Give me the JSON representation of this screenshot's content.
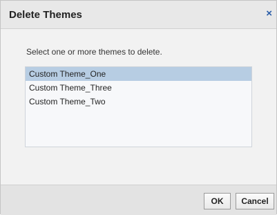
{
  "dialog": {
    "title": "Delete Themes",
    "close_glyph": "×",
    "instruction": "Select one or more themes to delete.",
    "themes": [
      {
        "label": "Custom Theme_One",
        "selected": true
      },
      {
        "label": "Custom Theme_Three",
        "selected": false
      },
      {
        "label": "Custom Theme_Two",
        "selected": false
      }
    ],
    "ok_label": "OK",
    "cancel_label": "Cancel"
  },
  "colors": {
    "selection": "#b7cde3",
    "close_icon": "#2a5da8",
    "titlebar": "#e8e8e8",
    "footer": "#e3e3e3"
  }
}
